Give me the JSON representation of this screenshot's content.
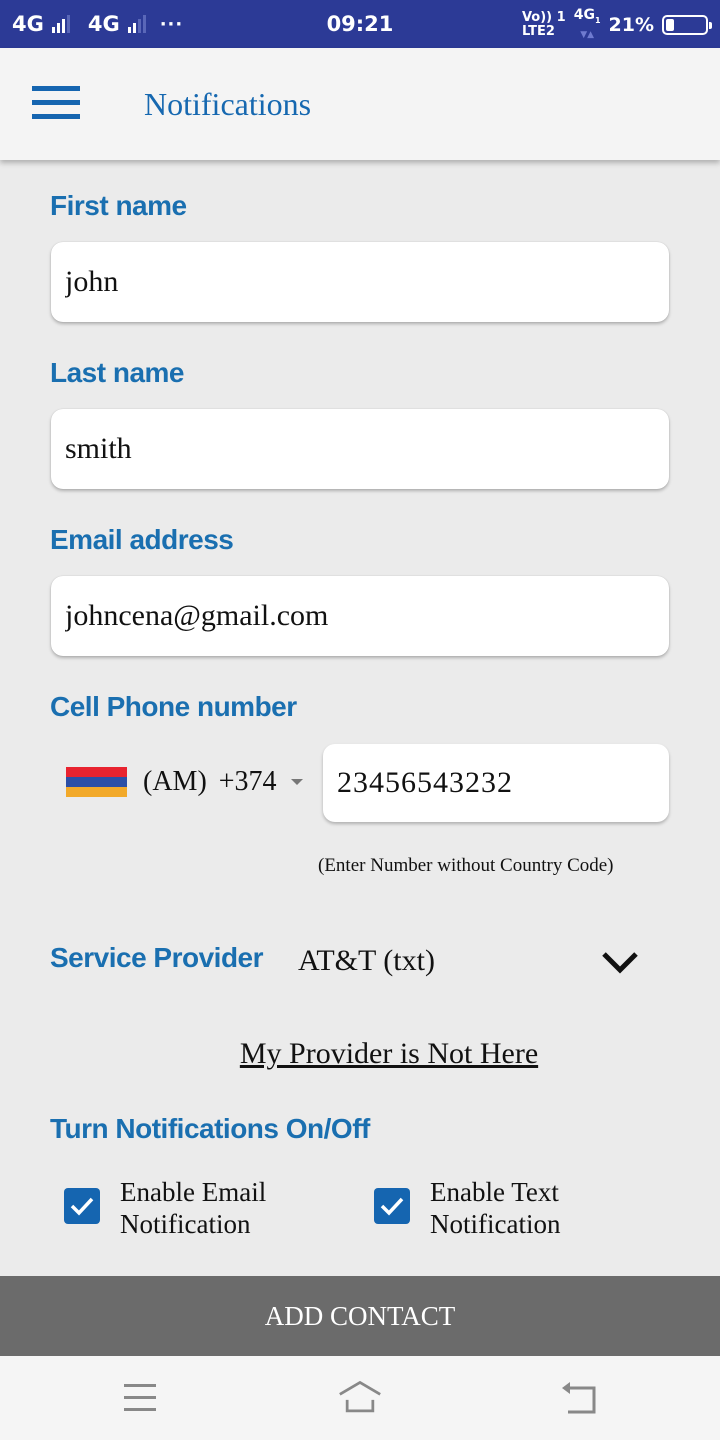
{
  "status_bar": {
    "sim1_network": "4G",
    "sim2_network": "4G",
    "more_indicator": "···",
    "time": "09:21",
    "volte_line1": "Vo)) 1",
    "volte_line2": "LTE2",
    "data_network": "4G",
    "data_sub": "1",
    "data_arrows": "▼▲",
    "battery_percent": "21%",
    "battery_level": 0.21
  },
  "app_bar": {
    "menu_icon": "hamburger-menu-icon",
    "title": "Notifications"
  },
  "form": {
    "first_name": {
      "label": "First name",
      "value": "john"
    },
    "last_name": {
      "label": "Last name",
      "value": "smith"
    },
    "email": {
      "label": "Email address",
      "value": "johncena@gmail.com"
    },
    "phone": {
      "label": "Cell Phone number",
      "country_flag": "armenia-flag",
      "flag_colors": [
        "#e8232f",
        "#2c4fa6",
        "#f2a92a"
      ],
      "country_code_label": "(AM)",
      "dial_code": "+374",
      "value": "23456543232",
      "hint": "(Enter Number without Country Code)"
    },
    "service_provider": {
      "label": "Service Provider",
      "selected": "AT&T (txt)",
      "link_label": "My Provider is Not Here"
    },
    "notifications": {
      "label": "Turn Notifications On/Off",
      "options": [
        {
          "label": "Enable Email Notification",
          "checked": true
        },
        {
          "label": "Enable Text Notification",
          "checked": true
        }
      ]
    }
  },
  "submit_button": {
    "label": "ADD CONTACT"
  },
  "nav_bar": {
    "buttons": [
      "recent-apps",
      "home",
      "back"
    ]
  },
  "colors": {
    "status_bar": "#2c3a96",
    "accent_blue": "#1668b0",
    "button_gray": "#6b6b6b",
    "page_bg": "#ebebeb"
  }
}
